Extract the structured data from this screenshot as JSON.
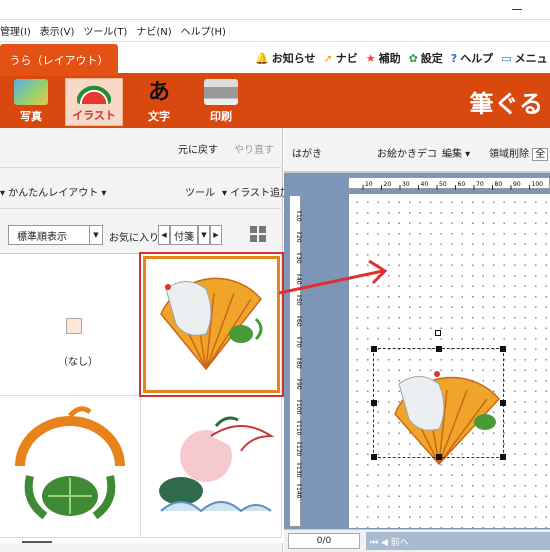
{
  "menubar": {
    "items": [
      "管理(I)",
      "表示(V)",
      "ツール(T)",
      "ナビ(N)",
      "ヘルプ(H)"
    ]
  },
  "ribbon_tabs": {
    "active": "うら（レイアウト）"
  },
  "top_links": {
    "notice": "お知らせ",
    "navi": "ナビ",
    "assist": "補助",
    "settings": "設定",
    "help": "ヘルプ",
    "menu": "メニュ"
  },
  "ribbon": {
    "buttons": [
      "写真",
      "イラスト",
      "文字",
      "印刷"
    ],
    "brand": "筆ぐる",
    "colors": {
      "ribbon": "#d9480f",
      "tab": "#e35114",
      "selected_border": "#d6322c",
      "thumb_border": "#e8841c"
    }
  },
  "left_pane": {
    "undo": "元に戻す",
    "redo": "やり直す",
    "easy_layout": "かんたんレイアウト",
    "tools": "ツール",
    "add_illust": "イラスト追加",
    "sort": "標準順表示",
    "favorite_label": "お気に入り",
    "tag": "付箋",
    "none_label": "（なし）"
  },
  "right_pane": {
    "mode": "はがき",
    "deco": "お絵かきデコ",
    "edit": "編集",
    "region_delete": "領域削除",
    "zoom_partial": "全",
    "page": "0/0",
    "nav": "前へ"
  },
  "ruler": {
    "h": [
      "10",
      "20",
      "30",
      "40",
      "50",
      "60",
      "70",
      "80",
      "90",
      "100"
    ],
    "v": [
      "10",
      "20",
      "30",
      "40",
      "50",
      "60",
      "70",
      "80",
      "90",
      "100",
      "110",
      "120",
      "130",
      "140"
    ]
  }
}
